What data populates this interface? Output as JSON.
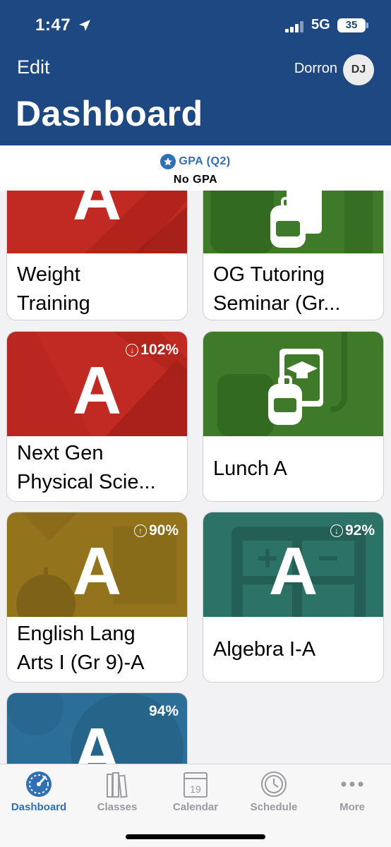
{
  "status_bar": {
    "time": "1:47",
    "network": "5G",
    "battery": "35"
  },
  "header": {
    "edit_label": "Edit",
    "user_name": "Dorron",
    "avatar_initials": "DJ",
    "title": "Dashboard",
    "background_color": "#1e4882"
  },
  "gpa": {
    "label": "GPA (Q2)",
    "value": "No GPA",
    "accent_color": "#2f6fb8"
  },
  "classes": [
    {
      "grade": "A",
      "percent": "",
      "trend": "",
      "title_line1": "Weight",
      "title_line2": "Training",
      "color": "#c02a22",
      "icon": "pencil-pattern"
    },
    {
      "grade": "",
      "percent": "",
      "trend": "",
      "title_line1": "OG Tutoring",
      "title_line2": "Seminar (Gr...",
      "color": "#3e7a2a",
      "icon": "backpack-book-icon"
    },
    {
      "grade": "A",
      "percent": "102%",
      "trend": "down",
      "title_line1": "Next Gen",
      "title_line2": "Physical Scie...",
      "color": "#c02a22",
      "icon": "pencil-pattern"
    },
    {
      "grade": "",
      "percent": "",
      "trend": "",
      "title_line1": "Lunch A",
      "title_line2": "",
      "color": "#3e7a2a",
      "icon": "backpack-book-icon"
    },
    {
      "grade": "A",
      "percent": "90%",
      "trend": "up",
      "title_line1": "English Lang",
      "title_line2": "Arts I (Gr 9)-A",
      "color": "#93741d",
      "icon": "apple-pattern"
    },
    {
      "grade": "A",
      "percent": "92%",
      "trend": "down",
      "title_line1": "Algebra I-A",
      "title_line2": "",
      "color": "#2c7266",
      "icon": "calculator-pattern"
    },
    {
      "grade": "A",
      "percent": "94%",
      "trend": "",
      "title_line1": "",
      "title_line2": "",
      "color": "#2b6e98",
      "icon": "globe-pattern"
    }
  ],
  "tabs": [
    {
      "label": "Dashboard",
      "icon": "speedometer-icon",
      "active": true
    },
    {
      "label": "Classes",
      "icon": "books-icon",
      "active": false
    },
    {
      "label": "Calendar",
      "icon": "calendar-icon",
      "active": false,
      "badge": "19"
    },
    {
      "label": "Schedule",
      "icon": "clock-icon",
      "active": false
    },
    {
      "label": "More",
      "icon": "more-icon",
      "active": false
    }
  ]
}
